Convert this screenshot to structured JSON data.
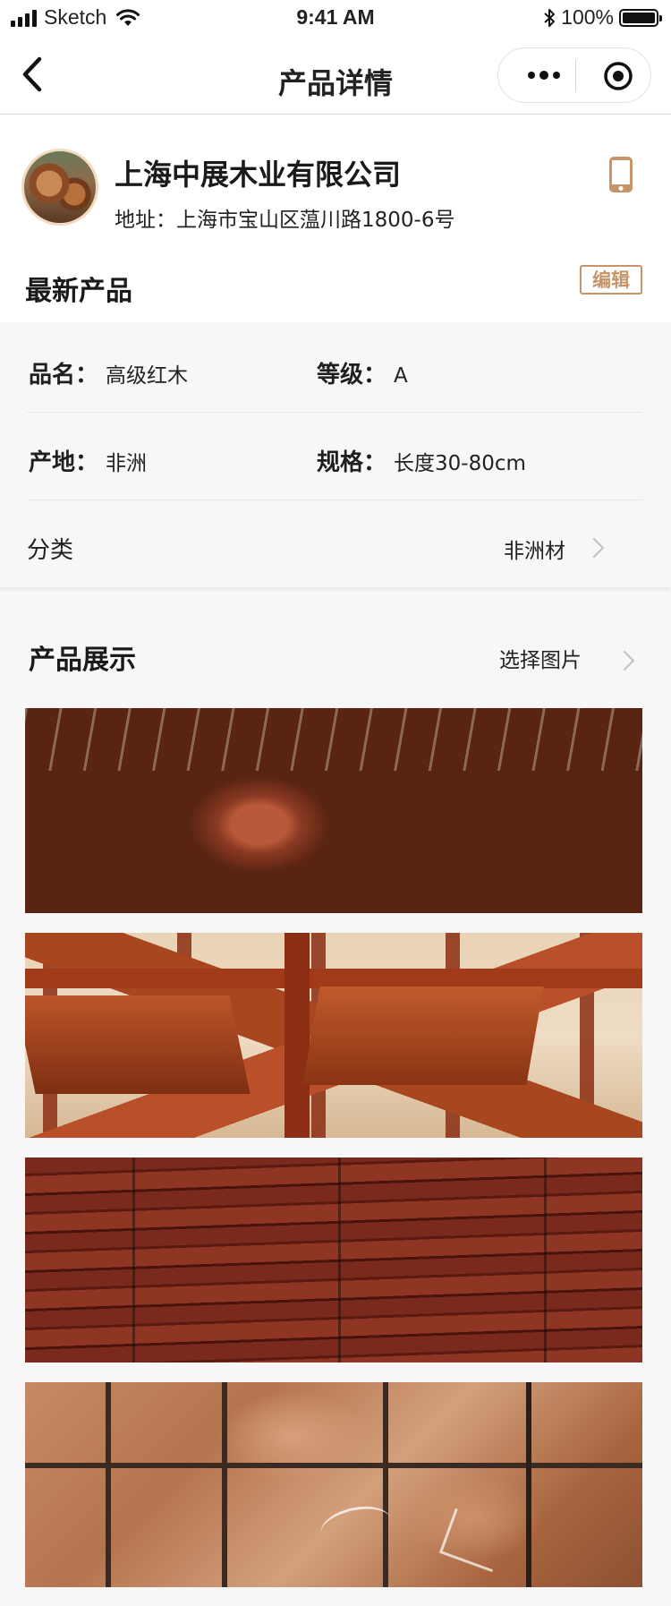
{
  "status_bar": {
    "carrier": "Sketch",
    "time": "9:41 AM",
    "battery": "100%"
  },
  "nav": {
    "title": "产品详情"
  },
  "company": {
    "name": "上海中展木业有限公司",
    "address": "地址：上海市宝山区蕰川路1800-6号",
    "latest_title": "最新产品",
    "edit_label": "编辑"
  },
  "product": {
    "name_label": "品名：",
    "name_value": "高级红木",
    "grade_label": "等级：",
    "grade_value": "A",
    "origin_label": "产地：",
    "origin_value": "非洲",
    "spec_label": "规格：",
    "spec_value": "长度30-80cm",
    "category_label": "分类",
    "category_value": "非洲材"
  },
  "showcase": {
    "title": "产品展示",
    "choose_label": "选择图片",
    "photos": [
      "logs-photo",
      "furniture-photo",
      "planks-photo",
      "blocks-photo"
    ]
  },
  "colors": {
    "accent": "#c8946a",
    "background": "#f7f7f7",
    "card": "#ffffff",
    "chevron": "#c2c2c2"
  }
}
